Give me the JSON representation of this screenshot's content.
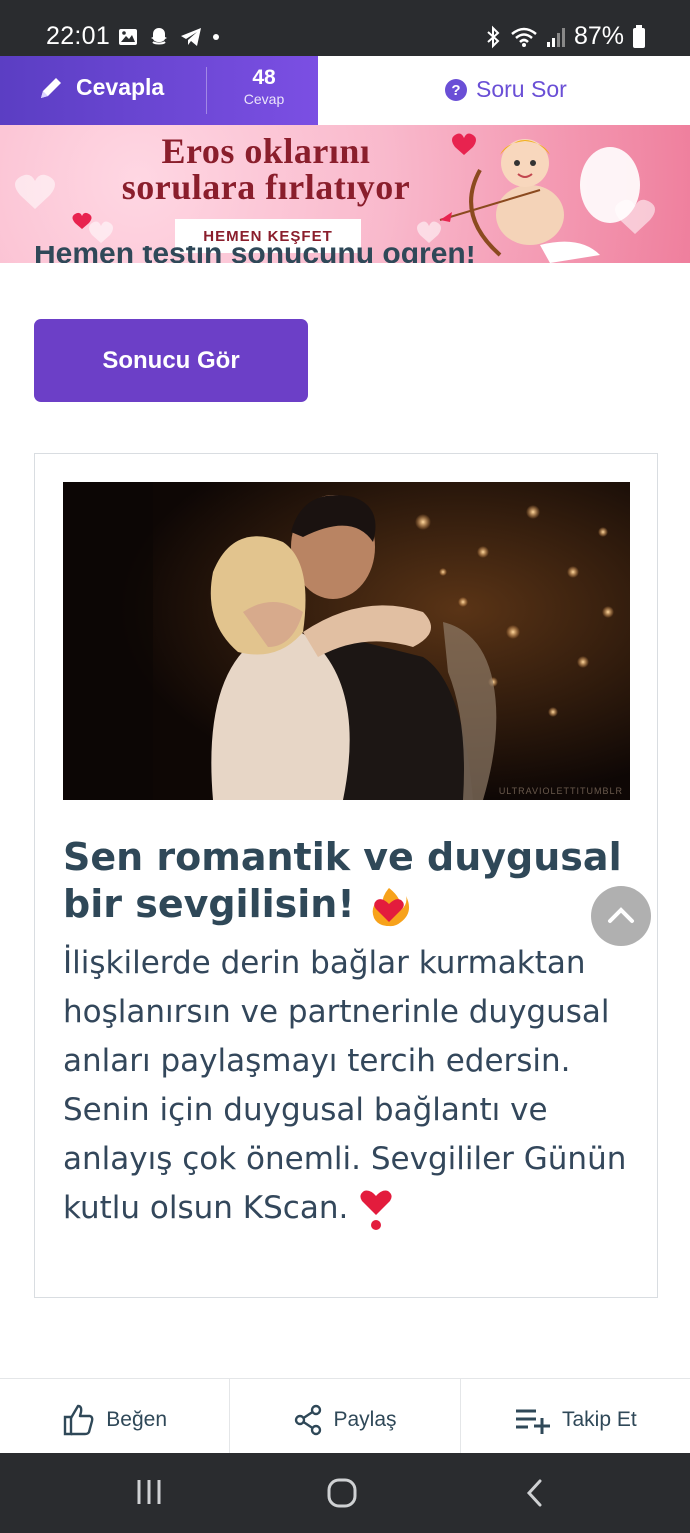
{
  "status_bar": {
    "time": "22:01",
    "battery": "87%",
    "icons_left": [
      "gallery-icon",
      "snapchat-icon",
      "telegram-icon",
      "dot-icon"
    ],
    "icons_right": [
      "bluetooth-icon",
      "wifi-icon",
      "signal-icon",
      "battery-icon"
    ]
  },
  "action_bar": {
    "answer_label": "Cevapla",
    "answer_count": "48",
    "answer_count_label": "Cevap",
    "ask_label": "Soru Sor"
  },
  "banner": {
    "title_line1": "Eros oklarını",
    "title_line2": "sorulara fırlatıyor",
    "cta": "HEMEN KEŞFET"
  },
  "partial_heading": "Hemen testin sonucunu öğren!",
  "result_button": "Sonucu Gör",
  "result": {
    "image_watermark": "ULTRAVIOLETTITUMBLR",
    "title": "Sen romantik ve duygusal bir sevgilisin!",
    "text": "İlişkilerde derin bağlar kurmaktan hoşlanırsın ve partnerinle duygusal anları paylaşmayı tercih edersin. Senin için duygusal bağlantı ve anlayış çok önemli. Sevgililer Günün kutlu olsun KScan."
  },
  "bottom_actions": {
    "like": "Beğen",
    "share": "Paylaş",
    "follow": "Takip Et"
  },
  "colors": {
    "primary": "#6c3fc7",
    "heading": "#2f4858",
    "system_bar": "#2a2c2f"
  }
}
